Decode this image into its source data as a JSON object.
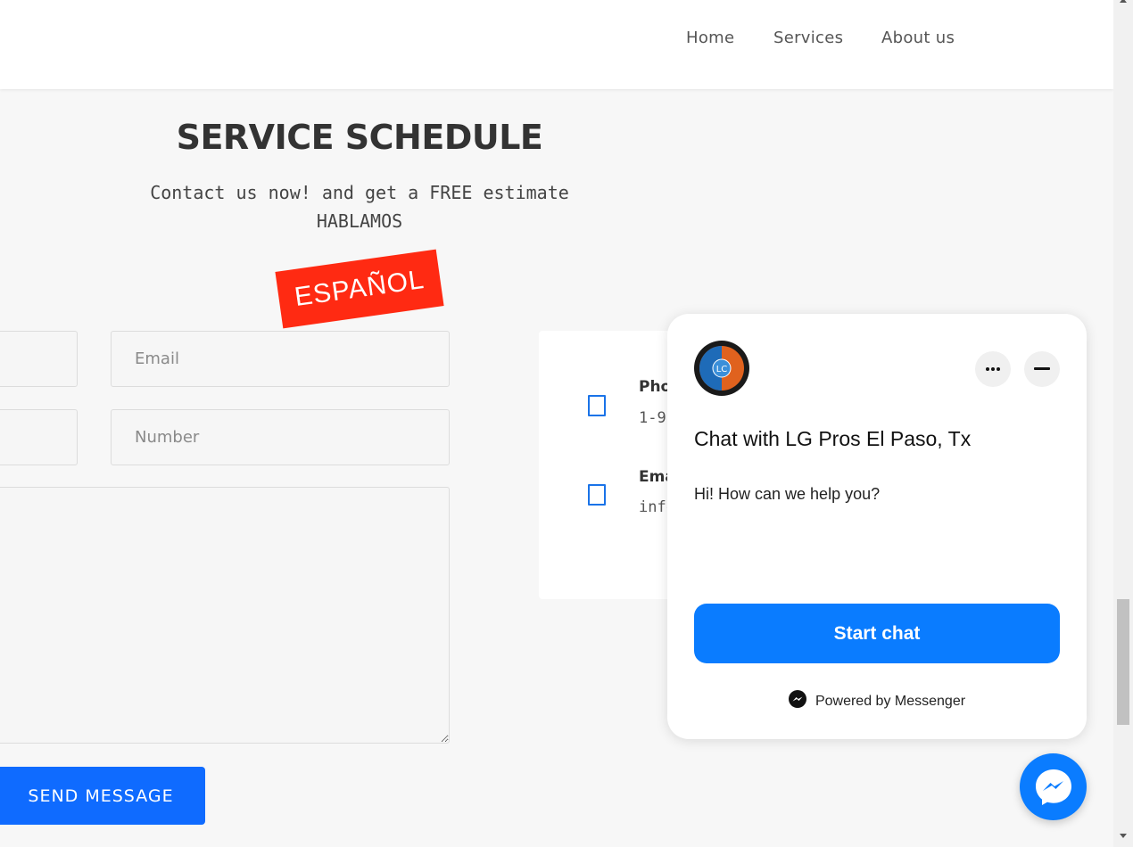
{
  "nav": {
    "items": [
      "Home",
      "Services",
      "About us"
    ]
  },
  "schedule": {
    "title": "SERVICE SCHEDULE",
    "subtitle_line1": "Contact us now! and get a FREE estimate",
    "subtitle_line2": "HABLAMOS",
    "badge": "ESPAÑOL"
  },
  "form": {
    "email_placeholder": "Email",
    "number_placeholder": "Number",
    "send_label": "SEND MESSAGE"
  },
  "contact_info": {
    "phone_label": "Pho",
    "phone_value": "1-9",
    "email_label": "Ema",
    "email_value": "info"
  },
  "chat": {
    "avatar_text": "LC",
    "title": "Chat with LG Pros El Paso, Tx",
    "greeting": "Hi! How can we help you?",
    "start_label": "Start chat",
    "powered_by": "Powered by Messenger",
    "accent_color": "#0a7cff"
  }
}
